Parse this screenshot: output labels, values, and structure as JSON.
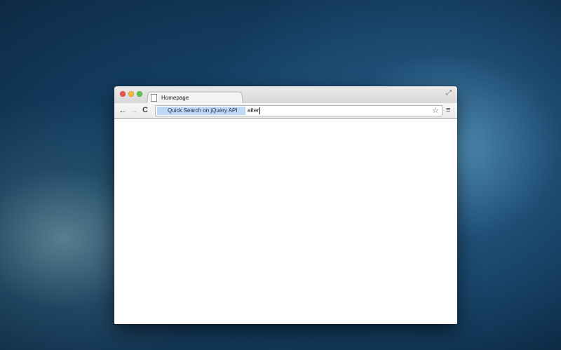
{
  "tab": {
    "title": "Homepage"
  },
  "omnibox": {
    "search_chip": "Quick Search on jQuery API",
    "typed_text": "after"
  },
  "icons": {
    "back": "←",
    "forward": "→",
    "reload": "C",
    "star": "☆",
    "menu": "≡",
    "fullscreen": "⤢"
  },
  "colors": {
    "close": "#f0524f",
    "minimize": "#f5bd3b",
    "maximize": "#5fc451",
    "search_chip_bg": "#bfd8f5"
  }
}
